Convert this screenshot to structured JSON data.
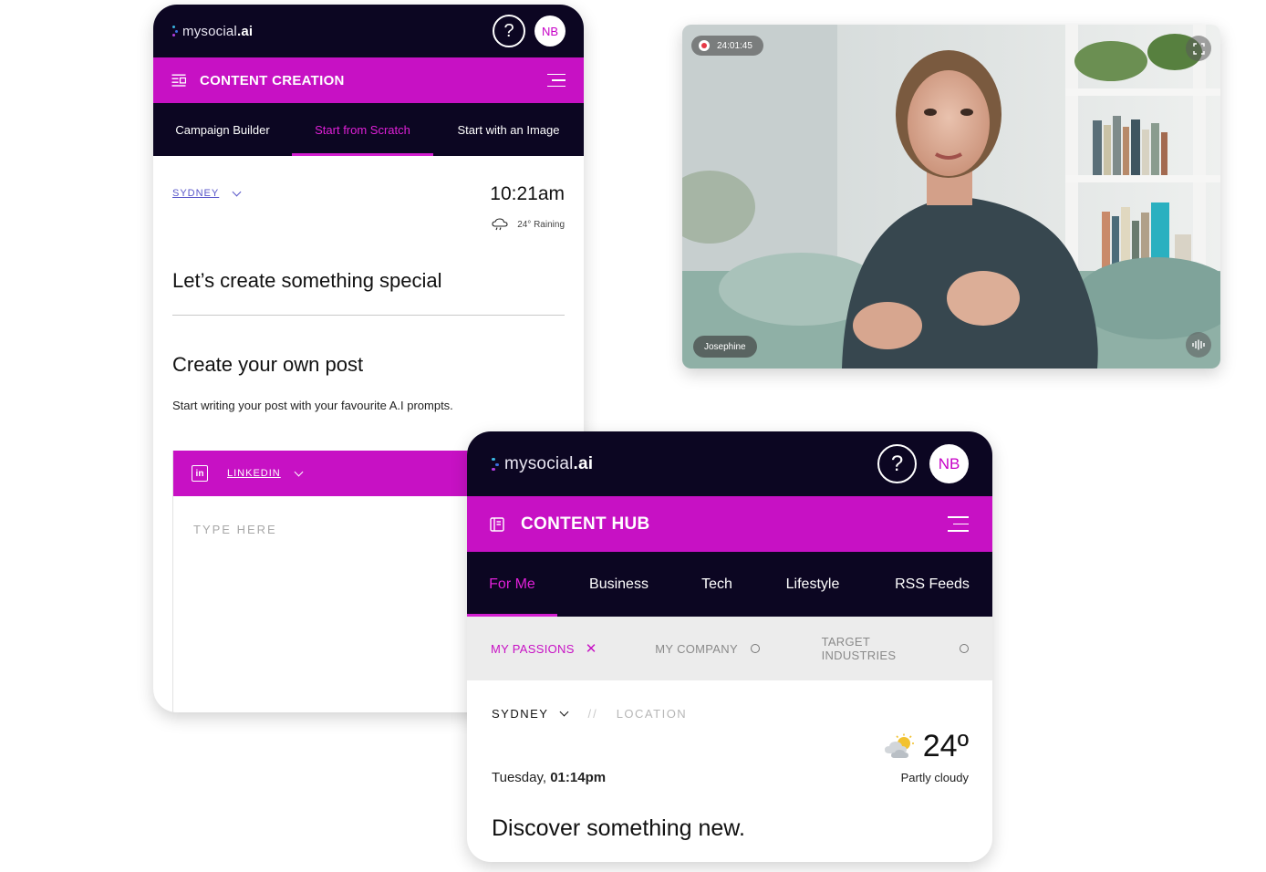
{
  "left_card": {
    "logo": {
      "main": "mysocial",
      "ai": ".ai"
    },
    "help_label": "?",
    "avatar_initials": "NB",
    "section_title": "CONTENT CREATION",
    "tabs": [
      {
        "label": "Campaign Builder"
      },
      {
        "label": "Start from Scratch"
      },
      {
        "label": "Start with an Image"
      }
    ],
    "active_tab": "Start from Scratch",
    "location": "SYDNEY",
    "time": "10:21am",
    "weather": "24° Raining",
    "heading": "Let’s create something special",
    "subheading": "Create your own post",
    "description": "Start writing your post with your favourite A.I prompts.",
    "platform": "LINKEDIN",
    "platform_icon": "linkedin-icon",
    "post_placeholder": "TYPE HERE"
  },
  "video": {
    "timer": "24:01:45",
    "participant_name": "Josephine",
    "icons": [
      "record-icon",
      "fullscreen-icon",
      "audio-wave-icon"
    ]
  },
  "hub_card": {
    "logo": {
      "main": "mysocial",
      "ai": ".ai"
    },
    "help_label": "?",
    "avatar_initials": "NB",
    "section_title": "CONTENT HUB",
    "tabs": [
      {
        "label": "For Me"
      },
      {
        "label": "Business"
      },
      {
        "label": "Tech"
      },
      {
        "label": "Lifestyle"
      },
      {
        "label": "RSS Feeds"
      }
    ],
    "active_tab": "For Me",
    "filters": [
      {
        "label": "MY PASSIONS",
        "state": "selected"
      },
      {
        "label": "MY COMPANY",
        "state": "unselected"
      },
      {
        "label": "TARGET INDUSTRIES",
        "state": "unselected"
      }
    ],
    "location": "SYDNEY",
    "location_separator": "//",
    "location_placeholder": "LOCATION",
    "date_prefix": "Tuesday, ",
    "time": "01:14pm",
    "temperature": "24º",
    "condition": "Partly cloudy",
    "heading": "Discover something new."
  },
  "colors": {
    "brand_magenta": "#c711c4",
    "nav_dark": "#0c0622",
    "accent_text": "#e020d8",
    "link_blue": "#5856c9"
  }
}
